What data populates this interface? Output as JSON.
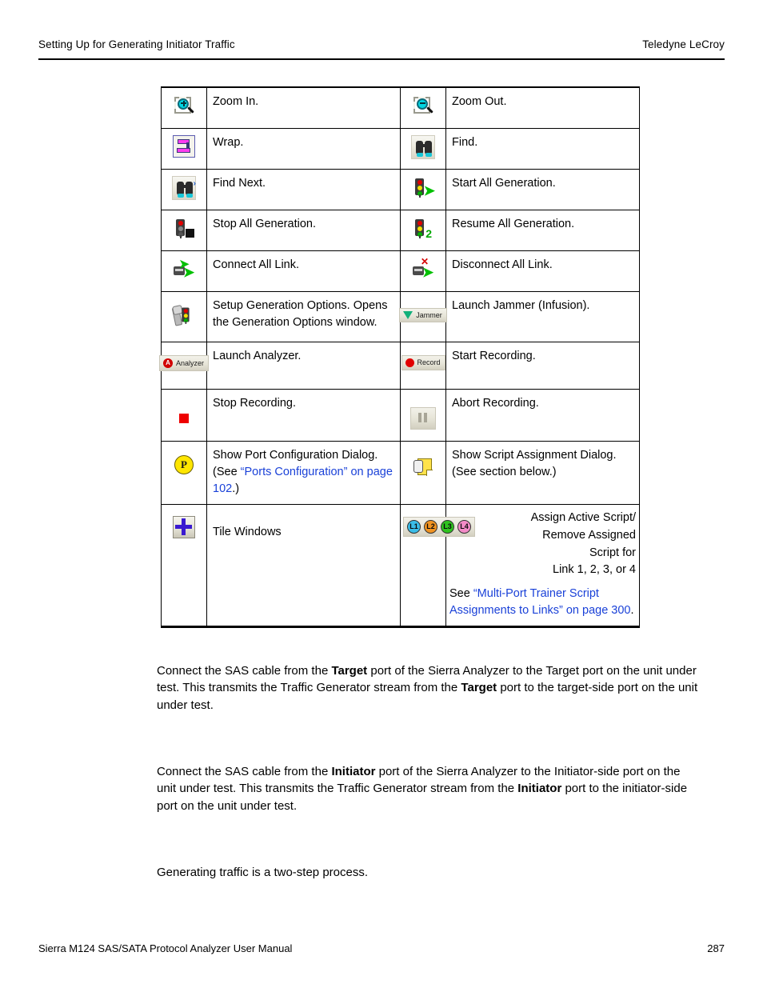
{
  "header": {
    "left": "Setting Up for Generating Initiator Traffic",
    "right": "Teledyne LeCroy"
  },
  "table": {
    "rows": [
      {
        "left": {
          "icon": "zoom-in-icon",
          "text": "Zoom In."
        },
        "right": {
          "icon": "zoom-out-icon",
          "text": "Zoom Out."
        }
      },
      {
        "left": {
          "icon": "wrap-icon",
          "text": "Wrap."
        },
        "right": {
          "icon": "find-icon",
          "text": "Find."
        }
      },
      {
        "left": {
          "icon": "find-next-icon",
          "text": "Find Next."
        },
        "right": {
          "icon": "start-all-generation-icon",
          "text": "Start All Generation."
        }
      },
      {
        "left": {
          "icon": "stop-all-generation-icon",
          "text": "Stop All Generation."
        },
        "right": {
          "icon": "resume-all-generation-icon",
          "text": "Resume All Generation."
        }
      },
      {
        "left": {
          "icon": "connect-all-link-icon",
          "text": "Connect All Link."
        },
        "right": {
          "icon": "disconnect-all-link-icon",
          "text": "Disconnect All Link."
        }
      },
      {
        "left": {
          "icon": "setup-generation-options-icon",
          "text": "Setup Generation Options. Opens the Generation Options window."
        },
        "right": {
          "icon": "jammer-button",
          "icon_label": "Jammer",
          "text": "Launch Jammer (Infusion)."
        }
      },
      {
        "left": {
          "icon": "analyzer-button",
          "icon_label": "Analyzer",
          "text": "Launch Analyzer."
        },
        "right": {
          "icon": "record-button",
          "icon_label": "Record",
          "text": "Start Recording."
        }
      },
      {
        "left": {
          "icon": "stop-recording-icon",
          "text": "Stop Recording."
        },
        "right": {
          "icon": "abort-recording-icon",
          "text": "Abort Recording."
        }
      },
      {
        "left": {
          "icon": "port-configuration-icon",
          "icon_label": "P",
          "text_parts": [
            {
              "t": "Show Port Configuration Dialog. (See ",
              "style": "plain"
            },
            {
              "t": "“Ports Configuration” on page 102",
              "style": "link"
            },
            {
              "t": ".)",
              "style": "plain"
            }
          ]
        },
        "right": {
          "icon": "script-assignment-icon",
          "text": "Show Script Assignment Dialog.\n(See section below.)"
        }
      }
    ],
    "last_row": {
      "left": {
        "icon": "tile-windows-icon",
        "text": "Tile Windows"
      },
      "right": {
        "icon": "link-buttons",
        "link_buttons": [
          {
            "label": "L1",
            "color": "#3bbde8"
          },
          {
            "label": "L2",
            "color": "#f19422"
          },
          {
            "label": "L3",
            "color": "#2ec31f"
          },
          {
            "label": "L4",
            "color": "#f48cc8"
          }
        ],
        "line1": "Assign Active Script/",
        "line2": "Remove Assigned",
        "line3": "Script for",
        "line4": "Link 1, 2, 3, or 4",
        "see_prefix": "See ",
        "see_link": "“Multi-Port Trainer Script Assignments to Links” on page 300",
        "see_suffix": "."
      }
    }
  },
  "paragraphs": {
    "p1": {
      "a": "Connect the SAS cable from the ",
      "b1": "Target",
      "c": " port of the Sierra Analyzer to the Target port on the unit under test. This transmits the Traffic Generator stream from the ",
      "b2": "Target",
      "d": " port to the target-side port on the unit under test."
    },
    "p2": {
      "a": "Connect the SAS cable from the ",
      "b1": "Initiator",
      "c": " port of the Sierra Analyzer to the Initiator-side port on the unit under test. This transmits the Traffic Generator stream from the ",
      "b2": "Initiator",
      "d": " port to the initiator-side port on the unit under test."
    },
    "p3": {
      "text": "Generating traffic is a two-step process."
    }
  },
  "footer": {
    "left": "Sierra M124 SAS/SATA Protocol Analyzer User Manual",
    "right": "287"
  },
  "colors": {
    "link": "#1a41d8",
    "text": "#000000"
  }
}
